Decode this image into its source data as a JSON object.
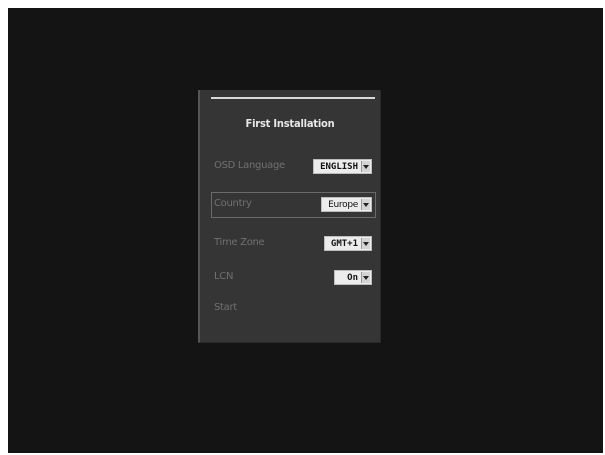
{
  "dialog": {
    "title": "First Installation",
    "rows": [
      {
        "label": "OSD Language",
        "value": "ENGLISH",
        "icon": "chevron-down-icon"
      },
      {
        "label": "Country",
        "value": "Europe",
        "icon": "chevron-down-icon",
        "selected": true
      },
      {
        "label": "Time Zone",
        "value": "GMT+1",
        "icon": "chevron-down-icon"
      },
      {
        "label": "LCN",
        "value": "On",
        "icon": "chevron-down-icon"
      }
    ],
    "start_label": "Start"
  },
  "colors": {
    "screen_background": "#141414",
    "panel_background": "#353535",
    "title_text": "#e8e8e8",
    "label_text": "#707070",
    "select_background": "#ececec"
  }
}
